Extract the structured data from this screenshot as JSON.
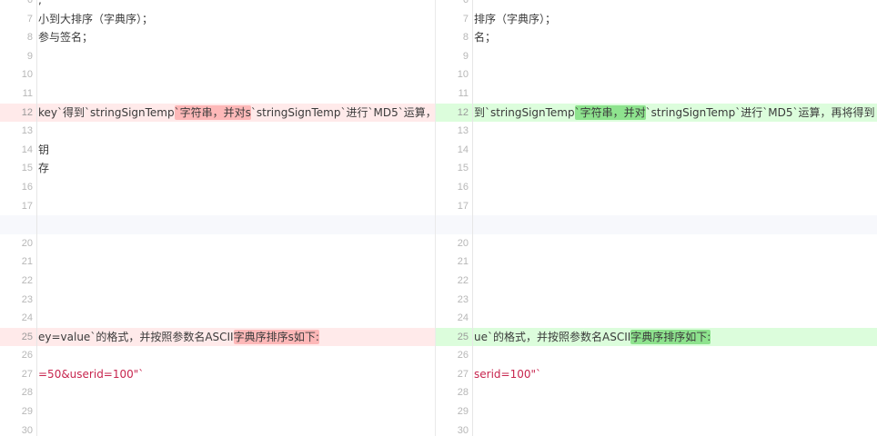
{
  "colors": {
    "deleted_line": "#ffeaea",
    "deleted_word": "#fdb8b8",
    "added_line": "#dcfddc",
    "added_word": "#8ee38e",
    "filler_line": "#f7f8fc",
    "inline_code": "#c7254e"
  },
  "left": {
    "rows": [
      {
        "ln": "6",
        "a": ",",
        "hl": "",
        "b": "",
        "type": "",
        "style": ""
      },
      {
        "ln": "7",
        "a": "小到大排序（字典序）；",
        "hl": "",
        "b": "",
        "type": "",
        "style": ""
      },
      {
        "ln": "8",
        "a": "参与签名；",
        "hl": "",
        "b": "",
        "type": "",
        "style": ""
      },
      {
        "ln": "9",
        "a": "",
        "hl": "",
        "b": "",
        "type": "",
        "style": ""
      },
      {
        "ln": "10",
        "a": "",
        "hl": "",
        "b": "",
        "type": "",
        "style": ""
      },
      {
        "ln": "11",
        "a": "",
        "hl": "",
        "b": "",
        "type": "",
        "style": ""
      },
      {
        "ln": "12",
        "a": " key`得到`stringSignTemp",
        "hl": "`字符串，并对s",
        "b": "`stringSignTemp`进行`MD5`运算，",
        "type": "del",
        "style": ""
      },
      {
        "ln": "13",
        "a": "",
        "hl": "",
        "b": "",
        "type": "",
        "style": ""
      },
      {
        "ln": "14",
        "a": "钥",
        "hl": "",
        "b": "",
        "type": "",
        "style": ""
      },
      {
        "ln": "15",
        "a": "存",
        "hl": "",
        "b": "",
        "type": "",
        "style": ""
      },
      {
        "ln": "16",
        "a": "",
        "hl": "",
        "b": "",
        "type": "",
        "style": ""
      },
      {
        "ln": "17",
        "a": "",
        "hl": "",
        "b": "",
        "type": "",
        "style": ""
      },
      {
        "ln": "",
        "a": "",
        "hl": "",
        "b": "",
        "type": "filler",
        "style": ""
      },
      {
        "ln": "20",
        "a": "",
        "hl": "",
        "b": "",
        "type": "",
        "style": ""
      },
      {
        "ln": "21",
        "a": "",
        "hl": "",
        "b": "",
        "type": "",
        "style": ""
      },
      {
        "ln": "22",
        "a": "",
        "hl": "",
        "b": "",
        "type": "",
        "style": ""
      },
      {
        "ln": "23",
        "a": "",
        "hl": "",
        "b": "",
        "type": "",
        "style": ""
      },
      {
        "ln": "24",
        "a": "",
        "hl": "",
        "b": "",
        "type": "",
        "style": ""
      },
      {
        "ln": "25",
        "a": "ey=value`的格式，并按照参数名ASCII",
        "hl": "字典序排序s如下:",
        "b": "",
        "type": "del",
        "style": ""
      },
      {
        "ln": "26",
        "a": "",
        "hl": "",
        "b": "",
        "type": "",
        "style": ""
      },
      {
        "ln": "27",
        "a": "=50&userid=100\"`",
        "hl": "",
        "b": "",
        "type": "",
        "style": "red"
      },
      {
        "ln": "28",
        "a": "",
        "hl": "",
        "b": "",
        "type": "",
        "style": ""
      },
      {
        "ln": "29",
        "a": "",
        "hl": "",
        "b": "",
        "type": "",
        "style": ""
      },
      {
        "ln": "30",
        "a": "",
        "hl": "",
        "b": "",
        "type": "",
        "style": ""
      }
    ]
  },
  "right": {
    "rows": [
      {
        "ln": "6",
        "a": "",
        "hl": "",
        "b": "",
        "type": "",
        "style": ""
      },
      {
        "ln": "7",
        "a": "排序（字典序）；",
        "hl": "",
        "b": "",
        "type": "",
        "style": ""
      },
      {
        "ln": "8",
        "a": "名；",
        "hl": "",
        "b": "",
        "type": "",
        "style": ""
      },
      {
        "ln": "9",
        "a": "",
        "hl": "",
        "b": "",
        "type": "",
        "style": ""
      },
      {
        "ln": "10",
        "a": "",
        "hl": "",
        "b": "",
        "type": "",
        "style": ""
      },
      {
        "ln": "11",
        "a": "",
        "hl": "",
        "b": "",
        "type": "",
        "style": ""
      },
      {
        "ln": "12",
        "a": "到`stringSignTemp",
        "hl": "`字符串，并对",
        "b": "`stringSignTemp`进行`MD5`运算，再将得到",
        "type": "add",
        "style": ""
      },
      {
        "ln": "13",
        "a": "",
        "hl": "",
        "b": "",
        "type": "",
        "style": ""
      },
      {
        "ln": "14",
        "a": "",
        "hl": "",
        "b": "",
        "type": "",
        "style": ""
      },
      {
        "ln": "15",
        "a": "",
        "hl": "",
        "b": "",
        "type": "",
        "style": ""
      },
      {
        "ln": "16",
        "a": "",
        "hl": "",
        "b": "",
        "type": "",
        "style": ""
      },
      {
        "ln": "17",
        "a": "",
        "hl": "",
        "b": "",
        "type": "",
        "style": ""
      },
      {
        "ln": "",
        "a": "",
        "hl": "",
        "b": "",
        "type": "filler",
        "style": ""
      },
      {
        "ln": "20",
        "a": "",
        "hl": "",
        "b": "",
        "type": "",
        "style": ""
      },
      {
        "ln": "21",
        "a": "",
        "hl": "",
        "b": "",
        "type": "",
        "style": ""
      },
      {
        "ln": "22",
        "a": "",
        "hl": "",
        "b": "",
        "type": "",
        "style": ""
      },
      {
        "ln": "23",
        "a": "",
        "hl": "",
        "b": "",
        "type": "",
        "style": ""
      },
      {
        "ln": "24",
        "a": "",
        "hl": "",
        "b": "",
        "type": "",
        "style": ""
      },
      {
        "ln": "25",
        "a": "ue`的格式，并按照参数名ASCII",
        "hl": "字典序排序如下:",
        "b": "",
        "type": "add",
        "style": ""
      },
      {
        "ln": "26",
        "a": "",
        "hl": "",
        "b": "",
        "type": "",
        "style": ""
      },
      {
        "ln": "27",
        "a": "serid=100\"`",
        "hl": "",
        "b": "",
        "type": "",
        "style": "red"
      },
      {
        "ln": "28",
        "a": "",
        "hl": "",
        "b": "",
        "type": "",
        "style": ""
      },
      {
        "ln": "29",
        "a": "",
        "hl": "",
        "b": "",
        "type": "",
        "style": ""
      },
      {
        "ln": "30",
        "a": "",
        "hl": "",
        "b": "",
        "type": "",
        "style": ""
      }
    ]
  }
}
